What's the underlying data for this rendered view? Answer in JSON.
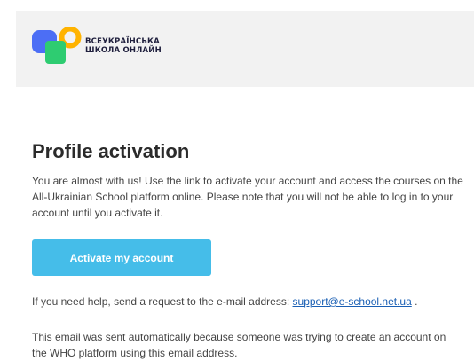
{
  "brand": {
    "line1": "ВСЕУКРАЇНСЬКА",
    "line2": "ШКОЛА ОНЛАЙН",
    "colors": {
      "blue": "#4c6ef5",
      "orange": "#ffb300",
      "green": "#2ecc71",
      "text": "#1f1f3d"
    }
  },
  "email": {
    "title": "Profile activation",
    "intro": "You are almost with us! Use the link to activate your account and access the courses on the All-Ukrainian School platform online. Please note that you will not be able to log in to your account until you activate it.",
    "button_label": "Activate my account",
    "button_color": "#45bde9",
    "help_prefix": "If you need help, send a request to the e-mail address: ",
    "help_email": "support@e-school.net.ua",
    "help_suffix": " .",
    "footer": "This email was sent automatically because someone was trying to create an account on the WHO platform using this email address."
  }
}
